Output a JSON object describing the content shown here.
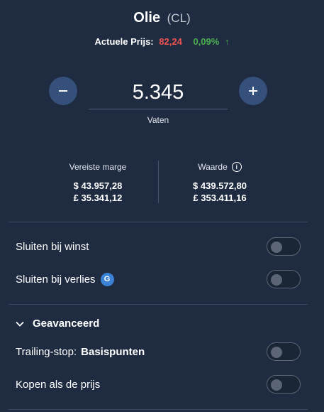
{
  "header": {
    "name": "Olie",
    "symbol": "(CL)",
    "price_label": "Actuele Prijs:",
    "price_value": "82,24",
    "change": "0,09%",
    "change_arrow": "↑"
  },
  "quantity": {
    "value": "5.345",
    "unit": "Vaten"
  },
  "metrics": {
    "margin_label": "Vereiste marge",
    "margin_usd": "$ 43.957,28",
    "margin_gbp": "£ 35.341,12",
    "value_label": "Waarde",
    "value_usd": "$ 439.572,80",
    "value_gbp": "£ 353.411,16"
  },
  "options": {
    "take_profit": "Sluiten bij winst",
    "stop_loss": "Sluiten bij verlies",
    "stop_loss_badge": "G"
  },
  "advanced": {
    "title": "Geavanceerd",
    "trailing_label": "Trailing-stop:",
    "trailing_value": "Basispunten",
    "buy_when": "Kopen als de prijs"
  },
  "colors": {
    "background": "#1e2b40",
    "negative": "#ef5350",
    "positive": "#4caf50",
    "button": "#35507a",
    "badge": "#3b82d6"
  }
}
